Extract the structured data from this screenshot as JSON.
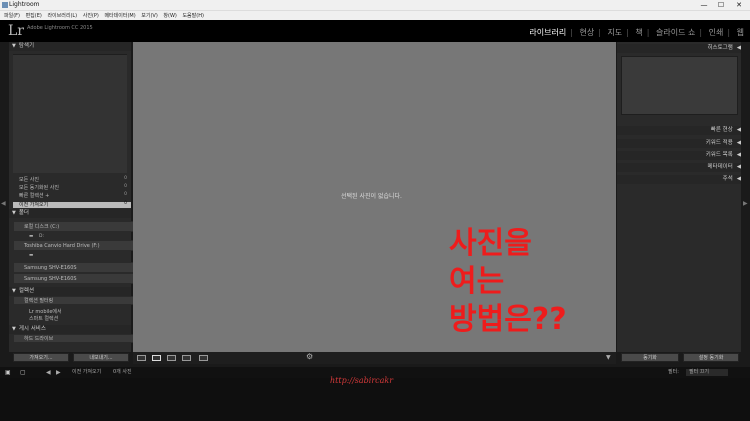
{
  "window": {
    "title": "Lightroom",
    "controls": [
      "—",
      "☐",
      "✕"
    ]
  },
  "menu": [
    "파일(F)",
    "편집(E)",
    "라이브러리(L)",
    "사진(P)",
    "메타데이터(M)",
    "보기(V)",
    "창(W)",
    "도움말(H)"
  ],
  "identity": {
    "logo": "Lr",
    "app_name": "Adobe Lightroom CC 2015",
    "app_sub": ""
  },
  "modules": [
    "라이브러리",
    "현상",
    "지도",
    "책",
    "슬라이드 쇼",
    "인쇄",
    "웹"
  ],
  "left_panel": {
    "navigator": "탐색기",
    "catalog_items": [
      {
        "label": "모든 사진",
        "count": "0"
      },
      {
        "label": "모든 동기화된 사진",
        "count": "0"
      },
      {
        "label": "빠른 컬렉션 +",
        "count": "0"
      },
      {
        "label": "이전 가져오기",
        "count": "0"
      }
    ],
    "folders": "폴더",
    "drives": [
      {
        "label": "로컬 디스크 (C:)",
        "size": ""
      },
      {
        "label": "Toshiba Canvio Hard Drive (F:)",
        "size": ""
      },
      {
        "label": "Samsung SHV-E160S",
        "size": ""
      },
      {
        "label": "Samsung SHV-E160S",
        "size": ""
      }
    ],
    "subfolder": "D:",
    "collections": "컬렉션",
    "collection_filter": "컬렉션 필터링",
    "collection_items": [
      "Lr mobile에서",
      "스마트 컬렉션"
    ],
    "publish": "게시 서비스",
    "publish_item": "하드 드라이브",
    "import_btn": "가져오기...",
    "export_btn": "내보내기..."
  },
  "center": {
    "no_photo": "선택된 사진이 없습니다.",
    "annotation": [
      "사진을",
      "여는",
      "방법은??"
    ]
  },
  "right_panel": {
    "histogram": "히스토그램",
    "quick_develop": "빠른 현상",
    "keywording": "키워드 적용",
    "keyword_list": "키워드 목록",
    "metadata": "메타데이터",
    "comments": "주석",
    "sync_meta_btn": "동기화",
    "sync_settings_btn": "설정 동기화"
  },
  "filmstrip": {
    "source": "이전 가져오기",
    "count": "0개 사진",
    "filter_label": "필터:",
    "filter_value": "필터 끄기"
  },
  "watermark": "http://sabircakr"
}
